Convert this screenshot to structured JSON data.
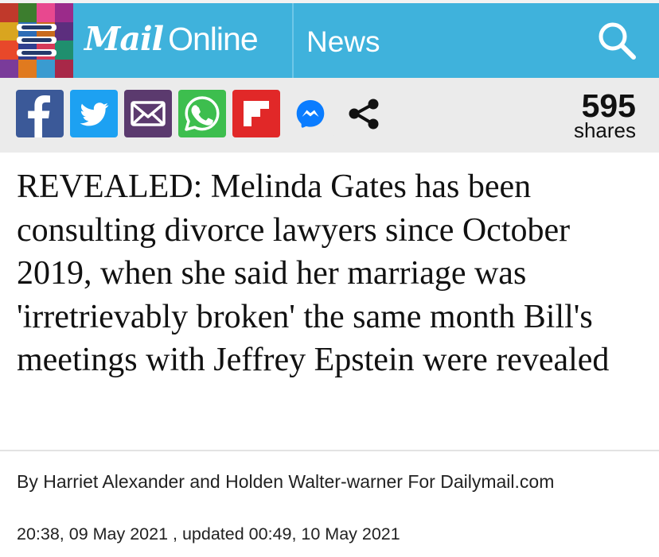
{
  "header": {
    "logo_mail": "Mail",
    "logo_online": "Online",
    "section": "News",
    "mosaic_colors": [
      "#c0392b",
      "#3c7d2e",
      "#e8488f",
      "#9b2b8a",
      "#d9a51f",
      "#2d6cb5",
      "#c86a1e",
      "#5c2e7e",
      "#e8482a",
      "#2f3f8f",
      "#d63a58",
      "#1f8f6e",
      "#7a3b9a",
      "#e07a1f",
      "#3a9bd0",
      "#a82848"
    ],
    "icons": {
      "menu": "hamburger-menu-icon",
      "search": "search-icon"
    }
  },
  "share": {
    "buttons": [
      {
        "name": "facebook",
        "icon": "facebook-icon",
        "color": "#3b5998"
      },
      {
        "name": "twitter",
        "icon": "twitter-icon",
        "color": "#1da1f2"
      },
      {
        "name": "email",
        "icon": "email-icon",
        "color": "#5b3a6e"
      },
      {
        "name": "whatsapp",
        "icon": "whatsapp-icon",
        "color": "#3dbe4e"
      },
      {
        "name": "flipboard",
        "icon": "flipboard-icon",
        "color": "#e12828"
      },
      {
        "name": "messenger",
        "icon": "messenger-icon",
        "color": "#0a7cff"
      },
      {
        "name": "more-share",
        "icon": "share-icon",
        "color": "#111111"
      }
    ],
    "count": "595",
    "count_label": "shares"
  },
  "article": {
    "headline": "REVEALED: Melinda Gates has been consulting divorce lawyers since October 2019, when she said her marriage was 'irretrievably broken' the same month Bill's meetings with Jeffrey Epstein were revealed",
    "byline_prefix": "By ",
    "author_1": "Harriet Alexander",
    "byline_and": " and ",
    "author_2": "Holden Walter-warner",
    "byline_suffix": " For Dailymail.com",
    "timestamp": "20:38, 09 May 2021 , updated 00:49, 10 May 2021"
  }
}
